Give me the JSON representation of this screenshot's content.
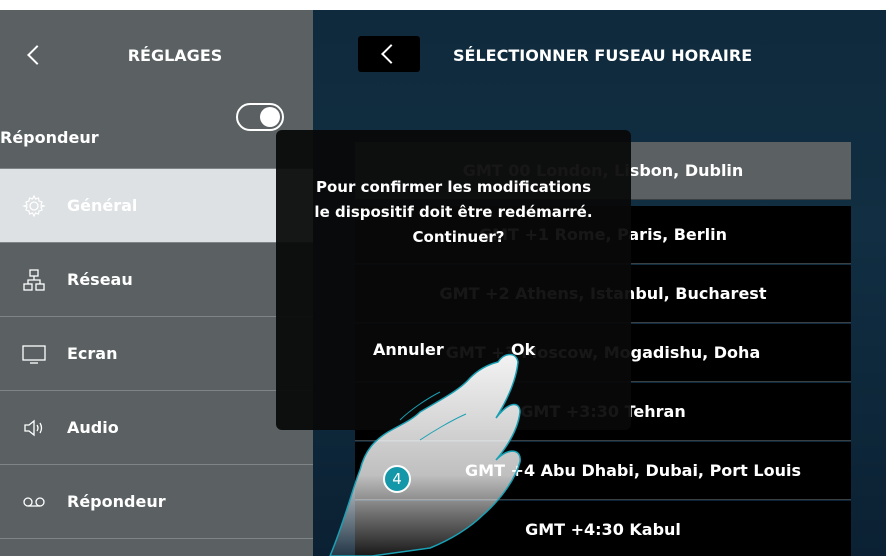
{
  "left_panel": {
    "title": "RÉGLAGES",
    "toggle_row_label": "Répondeur",
    "toggle_on": true,
    "items": [
      {
        "label": "Général",
        "icon": "gear-icon",
        "selected": true
      },
      {
        "label": "Réseau",
        "icon": "network-icon",
        "selected": false
      },
      {
        "label": "Ecran",
        "icon": "monitor-icon",
        "selected": false
      },
      {
        "label": "Audio",
        "icon": "speaker-icon",
        "selected": false
      },
      {
        "label": "Répondeur",
        "icon": "voicemail-icon",
        "selected": false
      }
    ]
  },
  "right_panel": {
    "title": "SÉLECTIONNER FUSEAU HORAIRE",
    "timezones": [
      {
        "label": "GMT 00 London, Lisbon, Dublin",
        "selected": true
      },
      {
        "label": "GMT +1 Rome, Paris, Berlin",
        "selected": false
      },
      {
        "label": "GMT +2 Athens, Istanbul, Bucharest",
        "selected": false
      },
      {
        "label": "GMT +3 Moscow, Mogadishu, Doha",
        "selected": false
      },
      {
        "label": "GMT +3:30 Tehran",
        "selected": false
      },
      {
        "label": "GMT +4 Abu Dhabi, Dubai, Port Louis",
        "selected": false
      },
      {
        "label": "GMT +4:30 Kabul",
        "selected": false
      }
    ]
  },
  "dialog": {
    "message_line1": "Pour confirmer les modifications",
    "message_line2": "le dispositif doit être redémarré.",
    "message_line3": "Continuer?",
    "cancel_label": "Annuler",
    "ok_label": "Ok"
  },
  "annotation": {
    "step_number": "4"
  },
  "colors": {
    "panel_gray": "#5b6163",
    "selected_item": "#dde1e3",
    "right_bg": "#0f2a3c",
    "accent_teal": "#1497a8"
  }
}
